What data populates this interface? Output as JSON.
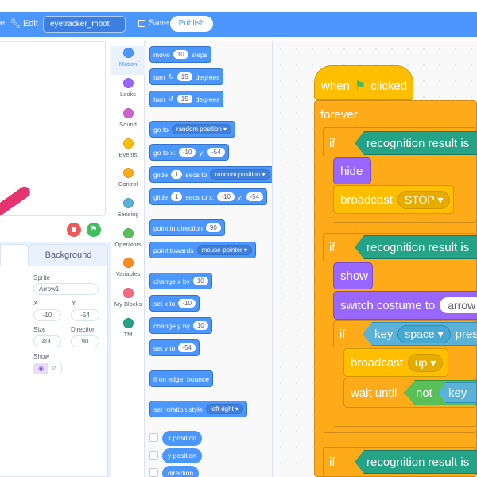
{
  "menubar": {
    "edit_partial": "e",
    "edit": "Edit",
    "project_name": "eyetracker_mbot",
    "save": "Save",
    "publish": "Publish"
  },
  "stage_controls": {
    "stop": "stop",
    "go": "⚑"
  },
  "tabs": {
    "background": "Background"
  },
  "sprite_info": {
    "sprite_label": "Sprite",
    "sprite_name": "Arrow1",
    "x_label": "X",
    "x_value": "-10",
    "y_label": "Y",
    "y_value": "-54",
    "size_label": "Size",
    "size_value": "400",
    "direction_label": "Direction",
    "direction_value": "90",
    "show_label": "Show"
  },
  "categories": [
    {
      "label": "Motion",
      "color": "#4c97ff"
    },
    {
      "label": "Looks",
      "color": "#9966ff"
    },
    {
      "label": "Sound",
      "color": "#cf63cf"
    },
    {
      "label": "Events",
      "color": "#ffbf00"
    },
    {
      "label": "Control",
      "color": "#ffab19"
    },
    {
      "label": "Sensing",
      "color": "#5cb1d6"
    },
    {
      "label": "Operators",
      "color": "#59c059"
    },
    {
      "label": "Variables",
      "color": "#ff8c1a"
    },
    {
      "label": "My Blocks",
      "color": "#ff6680"
    },
    {
      "label": "TM",
      "color": "#25a386"
    }
  ],
  "palette": {
    "move": {
      "t1": "move",
      "n": "10",
      "t2": "steps"
    },
    "turn_right": {
      "t1": "turn",
      "icon": "↻",
      "n": "15",
      "t2": "degrees"
    },
    "turn_left": {
      "t1": "turn",
      "icon": "↺",
      "n": "15",
      "t2": "degrees"
    },
    "goto": {
      "t1": "go to",
      "dd": "random position ▾"
    },
    "gotoxy": {
      "t1": "go to x:",
      "x": "-10",
      "t2": "y:",
      "y": "-54"
    },
    "glide_random": {
      "t1": "glide",
      "n": "1",
      "t2": "secs to",
      "dd": "random position ▾"
    },
    "glide_xy": {
      "t1": "glide",
      "n": "1",
      "t2": "secs to x:",
      "x": "-10",
      "t3": "y:",
      "y": "-54"
    },
    "point_dir": {
      "t1": "point in direction",
      "n": "90"
    },
    "point_towards": {
      "t1": "point towards",
      "dd": "mouse-pointer ▾"
    },
    "change_x": {
      "t1": "change x by",
      "n": "10"
    },
    "set_x": {
      "t1": "set x to",
      "n": "-10"
    },
    "change_y": {
      "t1": "change y by",
      "n": "10"
    },
    "set_y": {
      "t1": "set y to",
      "n": "-54"
    },
    "bounce": {
      "t1": "if on edge, bounce"
    },
    "rotation": {
      "t1": "set rotation style",
      "dd": "left-right ▾"
    },
    "reporters": [
      "x position",
      "y position",
      "direction"
    ]
  },
  "script": {
    "when_flag_t1": "when",
    "when_flag_t2": "clicked",
    "forever": "forever",
    "if1": "if",
    "rec1": "recognition result is",
    "hide": "hide",
    "broadcast1": "broadcast",
    "stop_msg": "STOP ▾",
    "if2": "if",
    "rec2": "recognition result is",
    "show": "show",
    "switch_costume": "switch costume to",
    "costume_dd": "arrow",
    "if3": "if",
    "key1": "key",
    "space_dd": "space ▾",
    "pressed": "pres",
    "broadcast2": "broadcast",
    "up_msg": "up ▾",
    "wait_until": "wait until",
    "not": "not",
    "key2": "key",
    "if4": "if",
    "rec3": "recognition result is"
  }
}
